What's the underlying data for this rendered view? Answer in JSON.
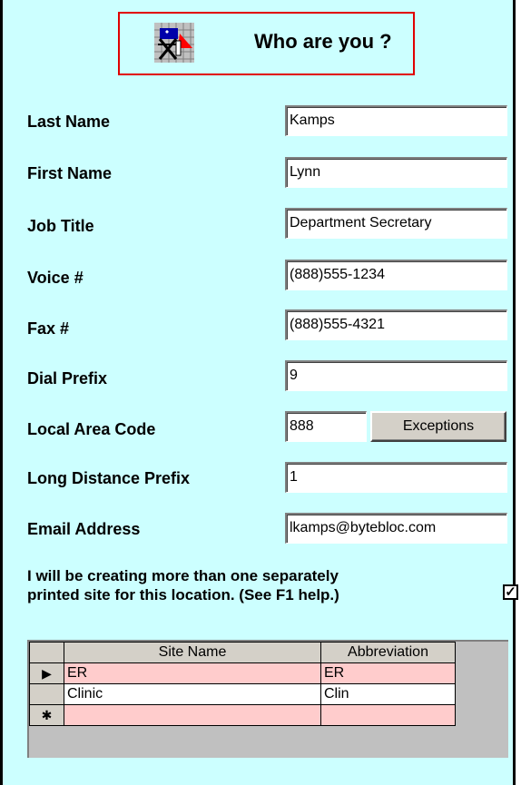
{
  "header": {
    "title": "Who are you ?",
    "icon": "director-chair-icon"
  },
  "fields": {
    "last_name": {
      "label": "Last Name",
      "value": "Kamps"
    },
    "first_name": {
      "label": "First Name",
      "value": "Lynn"
    },
    "job_title": {
      "label": "Job Title",
      "value": "Department Secretary"
    },
    "voice": {
      "label": "Voice #",
      "value": "(888)555-1234"
    },
    "fax": {
      "label": "Fax #",
      "value": "(888)555-4321"
    },
    "dial_prefix": {
      "label": "Dial Prefix",
      "value": "9"
    },
    "local_area_code": {
      "label": "Local Area Code",
      "value": "888"
    },
    "long_distance_prefix": {
      "label": "Long Distance Prefix",
      "value": "1"
    },
    "email": {
      "label": "Email Address",
      "value": "lkamps@bytebloc.com"
    }
  },
  "exceptions_button": "Exceptions",
  "multi_site": {
    "line1": "I will be creating more than one separately",
    "line2": "printed site for this location. (See F1 help.)",
    "checked": true,
    "check_glyph": "✓"
  },
  "grid": {
    "columns": [
      "Site Name",
      "Abbreviation"
    ],
    "rows": [
      {
        "marker": "▶",
        "site_name": "ER",
        "abbreviation": "ER"
      },
      {
        "marker": "",
        "site_name": "Clinic",
        "abbreviation": "Clin"
      },
      {
        "marker": "✱",
        "site_name": "",
        "abbreviation": ""
      }
    ]
  },
  "colors": {
    "panel_bg": "#ccffff",
    "header_border": "#e00000",
    "row_highlight": "#ffcccc"
  }
}
